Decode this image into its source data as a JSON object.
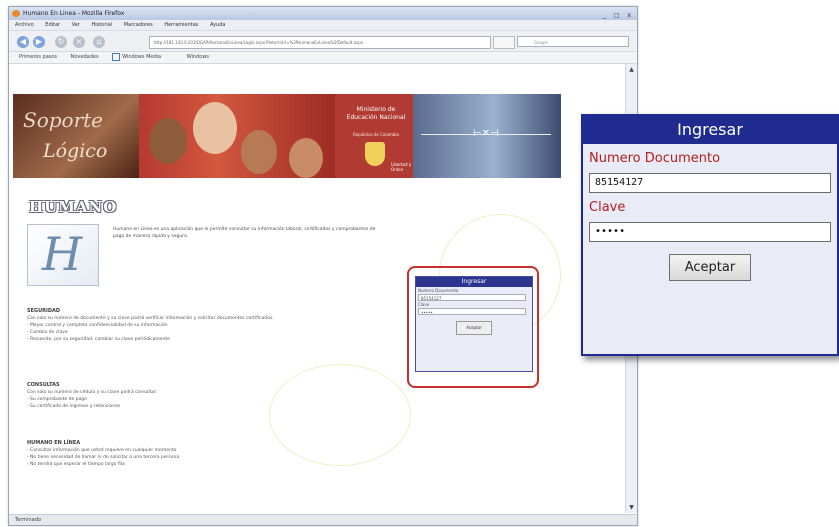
{
  "browser": {
    "window_title": "Humano En Linea - Mozilla Firefox",
    "window_buttons": "_ □ x",
    "menu": [
      "Archivo",
      "Editar",
      "Ver",
      "Historial",
      "Marcadores",
      "Herramientas",
      "Ayuda"
    ],
    "url": "http://181.143.0.203/DGAP/HumanoEnLinea/Login.aspx?ReturnUrl=%2fHumanoEnLinea%2fDefault.aspx",
    "search_placeholder": "Google",
    "bookmarks": [
      "Primeros pasos",
      "Novedades",
      "Windows Media",
      "Windows"
    ],
    "status": "Terminado"
  },
  "banner": {
    "brand_line1": "Soporte",
    "brand_line2": "Lógico",
    "ministry_line": "Ministerio de Educación Nacional",
    "ministry_sub": "República de Colombia",
    "ministry_tag": "Libertad y Orden"
  },
  "page": {
    "logo_title": "HUMANO",
    "logo_letter": "H",
    "intro": "Humano en Línea es una aplicación que le permite consultar su información laboral, certificados y comprobantes de pago de manera rápida y segura.",
    "sections": [
      {
        "head": "SEGURIDAD",
        "lines": [
          "Con solo su número de documento y su clave podrá verificar información y solicitar documentos certificados.",
          "- Mayor control y completa confidencialidad de su información",
          "- Cambio de clave",
          "- Recuerde, por su seguridad, cambiar su clave periódicamente"
        ]
      },
      {
        "head": "CONSULTAS",
        "lines": [
          "Con solo su número de cédula y su clave podrá consultar:",
          "- Su comprobante de pago",
          "- Su certificado de ingresos y retenciones"
        ]
      },
      {
        "head": "HUMANO EN LÍNEA",
        "lines": [
          "- Consultar información que usted requiere en cualquier momento",
          "- No tiene necesidad de llamar ni de solicitar a una tercera persona",
          "- No tendrá que esperar el tiempo largo fila"
        ]
      }
    ]
  },
  "mini_login": {
    "title": "Ingresar",
    "doc_label": "Numero Documento",
    "doc_value": "85154127",
    "pass_label": "Clave",
    "pass_value": "•••••",
    "button": "Aceptar"
  },
  "login": {
    "title": "Ingresar",
    "doc_label": "Numero Documento",
    "doc_value": "85154127",
    "pass_label": "Clave",
    "pass_value": "•••••",
    "button": "Aceptar"
  }
}
